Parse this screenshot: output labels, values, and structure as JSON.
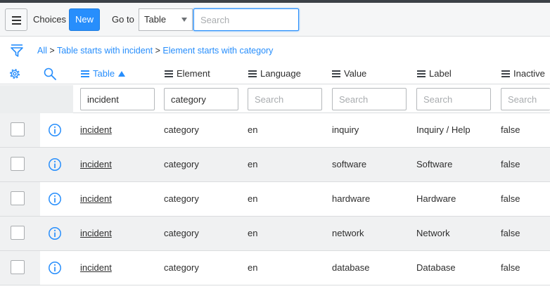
{
  "header": {
    "title": "Choices",
    "new_label": "New",
    "goto_label": "Go to",
    "goto_value": "Table",
    "search_placeholder": "Search"
  },
  "breadcrumb": {
    "all": "All",
    "sep": ">",
    "crumb1": "Table starts with incident",
    "crumb2": "Element starts with category"
  },
  "columns": {
    "table": "Table",
    "element": "Element",
    "language": "Language",
    "value": "Value",
    "label": "Label",
    "inactive": "Inactive"
  },
  "sort": {
    "column": "Table",
    "direction": "ascending"
  },
  "filters": {
    "table": "incident",
    "element": "category",
    "placeholder": "Search"
  },
  "rows": [
    {
      "table": "incident",
      "element": "category",
      "language": "en",
      "value": "inquiry",
      "label": "Inquiry / Help",
      "inactive": "false"
    },
    {
      "table": "incident",
      "element": "category",
      "language": "en",
      "value": "software",
      "label": "Software",
      "inactive": "false"
    },
    {
      "table": "incident",
      "element": "category",
      "language": "en",
      "value": "hardware",
      "label": "Hardware",
      "inactive": "false"
    },
    {
      "table": "incident",
      "element": "category",
      "language": "en",
      "value": "network",
      "label": "Network",
      "inactive": "false"
    },
    {
      "table": "incident",
      "element": "category",
      "language": "en",
      "value": "database",
      "label": "Database",
      "inactive": "false"
    }
  ],
  "colors": {
    "accent": "#278efc",
    "header_bg": "#f5f6f7",
    "row_alt": "#f0f1f2"
  },
  "icons": [
    "hamburger-menu-icon",
    "filter-funnel-icon",
    "gear-icon",
    "search-icon",
    "info-icon",
    "sort-up-icon"
  ]
}
